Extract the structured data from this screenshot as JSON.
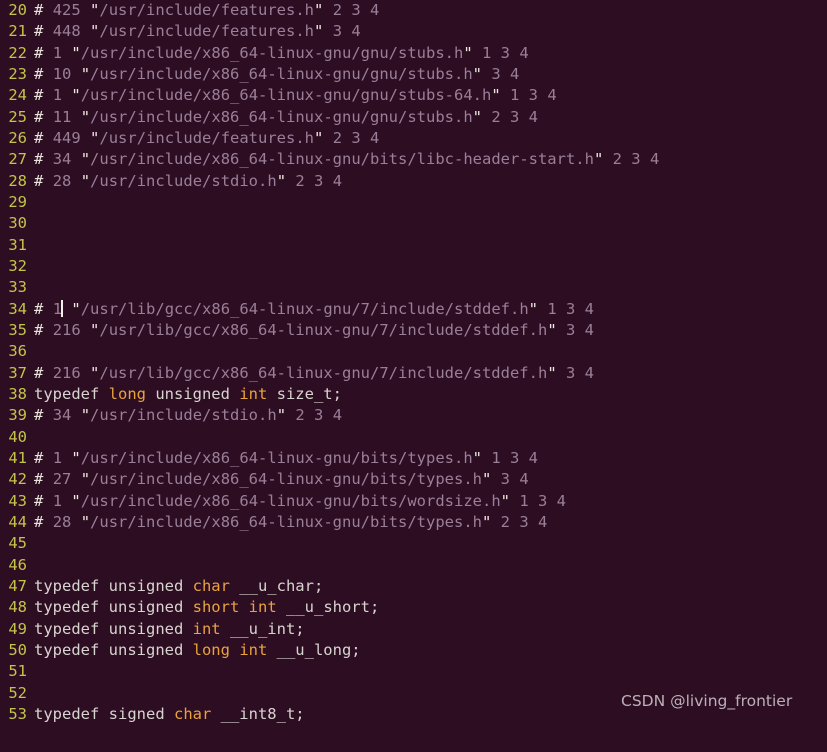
{
  "editor": {
    "background_color": "#2d0d22",
    "line_number_color": "#c4c44a",
    "first_visible_line": 20,
    "cursor": {
      "line": 34,
      "after_text": "# 1"
    },
    "lines": [
      {
        "num": "20",
        "tokens": [
          {
            "t": "hash",
            "v": "#"
          },
          {
            "t": "plainspace",
            "v": " "
          },
          {
            "t": "num",
            "v": "425"
          },
          {
            "t": "plainspace",
            "v": " "
          },
          {
            "t": "quote",
            "v": "\""
          },
          {
            "t": "path",
            "v": "/usr/include/features.h"
          },
          {
            "t": "quote",
            "v": "\""
          },
          {
            "t": "num",
            "v": " 2 3 4"
          }
        ]
      },
      {
        "num": "21",
        "tokens": [
          {
            "t": "hash",
            "v": "#"
          },
          {
            "t": "plainspace",
            "v": " "
          },
          {
            "t": "num",
            "v": "448"
          },
          {
            "t": "plainspace",
            "v": " "
          },
          {
            "t": "quote",
            "v": "\""
          },
          {
            "t": "path",
            "v": "/usr/include/features.h"
          },
          {
            "t": "quote",
            "v": "\""
          },
          {
            "t": "num",
            "v": " 3 4"
          }
        ]
      },
      {
        "num": "22",
        "tokens": [
          {
            "t": "hash",
            "v": "#"
          },
          {
            "t": "plainspace",
            "v": " "
          },
          {
            "t": "num",
            "v": "1"
          },
          {
            "t": "plainspace",
            "v": " "
          },
          {
            "t": "quote",
            "v": "\""
          },
          {
            "t": "path",
            "v": "/usr/include/x86_64-linux-gnu/gnu/stubs.h"
          },
          {
            "t": "quote",
            "v": "\""
          },
          {
            "t": "num",
            "v": " 1 3 4"
          }
        ]
      },
      {
        "num": "23",
        "tokens": [
          {
            "t": "hash",
            "v": "#"
          },
          {
            "t": "plainspace",
            "v": " "
          },
          {
            "t": "num",
            "v": "10"
          },
          {
            "t": "plainspace",
            "v": " "
          },
          {
            "t": "quote",
            "v": "\""
          },
          {
            "t": "path",
            "v": "/usr/include/x86_64-linux-gnu/gnu/stubs.h"
          },
          {
            "t": "quote",
            "v": "\""
          },
          {
            "t": "num",
            "v": " 3 4"
          }
        ]
      },
      {
        "num": "24",
        "tokens": [
          {
            "t": "hash",
            "v": "#"
          },
          {
            "t": "plainspace",
            "v": " "
          },
          {
            "t": "num",
            "v": "1"
          },
          {
            "t": "plainspace",
            "v": " "
          },
          {
            "t": "quote",
            "v": "\""
          },
          {
            "t": "path",
            "v": "/usr/include/x86_64-linux-gnu/gnu/stubs-64.h"
          },
          {
            "t": "quote",
            "v": "\""
          },
          {
            "t": "num",
            "v": " 1 3 4"
          }
        ]
      },
      {
        "num": "25",
        "tokens": [
          {
            "t": "hash",
            "v": "#"
          },
          {
            "t": "plainspace",
            "v": " "
          },
          {
            "t": "num",
            "v": "11"
          },
          {
            "t": "plainspace",
            "v": " "
          },
          {
            "t": "quote",
            "v": "\""
          },
          {
            "t": "path",
            "v": "/usr/include/x86_64-linux-gnu/gnu/stubs.h"
          },
          {
            "t": "quote",
            "v": "\""
          },
          {
            "t": "num",
            "v": " 2 3 4"
          }
        ]
      },
      {
        "num": "26",
        "tokens": [
          {
            "t": "hash",
            "v": "#"
          },
          {
            "t": "plainspace",
            "v": " "
          },
          {
            "t": "num",
            "v": "449"
          },
          {
            "t": "plainspace",
            "v": " "
          },
          {
            "t": "quote",
            "v": "\""
          },
          {
            "t": "path",
            "v": "/usr/include/features.h"
          },
          {
            "t": "quote",
            "v": "\""
          },
          {
            "t": "num",
            "v": " 2 3 4"
          }
        ]
      },
      {
        "num": "27",
        "tokens": [
          {
            "t": "hash",
            "v": "#"
          },
          {
            "t": "plainspace",
            "v": " "
          },
          {
            "t": "num",
            "v": "34"
          },
          {
            "t": "plainspace",
            "v": " "
          },
          {
            "t": "quote",
            "v": "\""
          },
          {
            "t": "path",
            "v": "/usr/include/x86_64-linux-gnu/bits/libc-header-start.h"
          },
          {
            "t": "quote",
            "v": "\""
          },
          {
            "t": "num",
            "v": " 2 3 4"
          }
        ]
      },
      {
        "num": "28",
        "tokens": [
          {
            "t": "hash",
            "v": "#"
          },
          {
            "t": "plainspace",
            "v": " "
          },
          {
            "t": "num",
            "v": "28"
          },
          {
            "t": "plainspace",
            "v": " "
          },
          {
            "t": "quote",
            "v": "\""
          },
          {
            "t": "path",
            "v": "/usr/include/stdio.h"
          },
          {
            "t": "quote",
            "v": "\""
          },
          {
            "t": "num",
            "v": " 2 3 4"
          }
        ]
      },
      {
        "num": "29",
        "tokens": []
      },
      {
        "num": "30",
        "tokens": []
      },
      {
        "num": "31",
        "tokens": []
      },
      {
        "num": "32",
        "tokens": []
      },
      {
        "num": "33",
        "tokens": []
      },
      {
        "num": "34",
        "tokens": [
          {
            "t": "hash",
            "v": "#"
          },
          {
            "t": "plainspace",
            "v": " "
          },
          {
            "t": "num",
            "v": "1"
          },
          {
            "t": "cursor",
            "v": ""
          },
          {
            "t": "plainspace",
            "v": " "
          },
          {
            "t": "quote",
            "v": "\""
          },
          {
            "t": "path",
            "v": "/usr/lib/gcc/x86_64-linux-gnu/7/include/stddef.h"
          },
          {
            "t": "quote",
            "v": "\""
          },
          {
            "t": "num",
            "v": " 1 3 4"
          }
        ]
      },
      {
        "num": "35",
        "tokens": [
          {
            "t": "hash",
            "v": "#"
          },
          {
            "t": "plainspace",
            "v": " "
          },
          {
            "t": "num",
            "v": "216"
          },
          {
            "t": "plainspace",
            "v": " "
          },
          {
            "t": "quote",
            "v": "\""
          },
          {
            "t": "path",
            "v": "/usr/lib/gcc/x86_64-linux-gnu/7/include/stddef.h"
          },
          {
            "t": "quote",
            "v": "\""
          },
          {
            "t": "num",
            "v": " 3 4"
          }
        ]
      },
      {
        "num": "36",
        "tokens": []
      },
      {
        "num": "37",
        "tokens": [
          {
            "t": "hash",
            "v": "#"
          },
          {
            "t": "plainspace",
            "v": " "
          },
          {
            "t": "num",
            "v": "216"
          },
          {
            "t": "plainspace",
            "v": " "
          },
          {
            "t": "quote",
            "v": "\""
          },
          {
            "t": "path",
            "v": "/usr/lib/gcc/x86_64-linux-gnu/7/include/stddef.h"
          },
          {
            "t": "quote",
            "v": "\""
          },
          {
            "t": "num",
            "v": " 3 4"
          }
        ]
      },
      {
        "num": "38",
        "tokens": [
          {
            "t": "plain",
            "v": "typedef "
          },
          {
            "t": "type",
            "v": "long"
          },
          {
            "t": "plain",
            "v": " unsigned "
          },
          {
            "t": "type",
            "v": "int"
          },
          {
            "t": "plain",
            "v": " size_t;"
          }
        ]
      },
      {
        "num": "39",
        "tokens": [
          {
            "t": "hash",
            "v": "#"
          },
          {
            "t": "plainspace",
            "v": " "
          },
          {
            "t": "num",
            "v": "34"
          },
          {
            "t": "plainspace",
            "v": " "
          },
          {
            "t": "quote",
            "v": "\""
          },
          {
            "t": "path",
            "v": "/usr/include/stdio.h"
          },
          {
            "t": "quote",
            "v": "\""
          },
          {
            "t": "num",
            "v": " 2 3 4"
          }
        ]
      },
      {
        "num": "40",
        "tokens": []
      },
      {
        "num": "41",
        "tokens": [
          {
            "t": "hash",
            "v": "#"
          },
          {
            "t": "plainspace",
            "v": " "
          },
          {
            "t": "num",
            "v": "1"
          },
          {
            "t": "plainspace",
            "v": " "
          },
          {
            "t": "quote",
            "v": "\""
          },
          {
            "t": "path",
            "v": "/usr/include/x86_64-linux-gnu/bits/types.h"
          },
          {
            "t": "quote",
            "v": "\""
          },
          {
            "t": "num",
            "v": " 1 3 4"
          }
        ]
      },
      {
        "num": "42",
        "tokens": [
          {
            "t": "hash",
            "v": "#"
          },
          {
            "t": "plainspace",
            "v": " "
          },
          {
            "t": "num",
            "v": "27"
          },
          {
            "t": "plainspace",
            "v": " "
          },
          {
            "t": "quote",
            "v": "\""
          },
          {
            "t": "path",
            "v": "/usr/include/x86_64-linux-gnu/bits/types.h"
          },
          {
            "t": "quote",
            "v": "\""
          },
          {
            "t": "num",
            "v": " 3 4"
          }
        ]
      },
      {
        "num": "43",
        "tokens": [
          {
            "t": "hash",
            "v": "#"
          },
          {
            "t": "plainspace",
            "v": " "
          },
          {
            "t": "num",
            "v": "1"
          },
          {
            "t": "plainspace",
            "v": " "
          },
          {
            "t": "quote",
            "v": "\""
          },
          {
            "t": "path",
            "v": "/usr/include/x86_64-linux-gnu/bits/wordsize.h"
          },
          {
            "t": "quote",
            "v": "\""
          },
          {
            "t": "num",
            "v": " 1 3 4"
          }
        ]
      },
      {
        "num": "44",
        "tokens": [
          {
            "t": "hash",
            "v": "#"
          },
          {
            "t": "plainspace",
            "v": " "
          },
          {
            "t": "num",
            "v": "28"
          },
          {
            "t": "plainspace",
            "v": " "
          },
          {
            "t": "quote",
            "v": "\""
          },
          {
            "t": "path",
            "v": "/usr/include/x86_64-linux-gnu/bits/types.h"
          },
          {
            "t": "quote",
            "v": "\""
          },
          {
            "t": "num",
            "v": " 2 3 4"
          }
        ]
      },
      {
        "num": "45",
        "tokens": []
      },
      {
        "num": "46",
        "tokens": []
      },
      {
        "num": "47",
        "tokens": [
          {
            "t": "plain",
            "v": "typedef unsigned "
          },
          {
            "t": "type",
            "v": "char"
          },
          {
            "t": "plain",
            "v": " __u_char;"
          }
        ]
      },
      {
        "num": "48",
        "tokens": [
          {
            "t": "plain",
            "v": "typedef unsigned "
          },
          {
            "t": "type",
            "v": "short"
          },
          {
            "t": "plain",
            "v": " "
          },
          {
            "t": "type",
            "v": "int"
          },
          {
            "t": "plain",
            "v": " __u_short;"
          }
        ]
      },
      {
        "num": "49",
        "tokens": [
          {
            "t": "plain",
            "v": "typedef unsigned "
          },
          {
            "t": "type",
            "v": "int"
          },
          {
            "t": "plain",
            "v": " __u_int;"
          }
        ]
      },
      {
        "num": "50",
        "tokens": [
          {
            "t": "plain",
            "v": "typedef unsigned "
          },
          {
            "t": "type",
            "v": "long"
          },
          {
            "t": "plain",
            "v": " "
          },
          {
            "t": "type",
            "v": "int"
          },
          {
            "t": "plain",
            "v": " __u_long;"
          }
        ]
      },
      {
        "num": "51",
        "tokens": []
      },
      {
        "num": "52",
        "tokens": []
      },
      {
        "num": "53",
        "tokens": [
          {
            "t": "plain",
            "v": "typedef signed "
          },
          {
            "t": "type",
            "v": "char"
          },
          {
            "t": "plain",
            "v": " __int8_t;"
          }
        ]
      }
    ]
  },
  "watermark": {
    "text": "CSDN @living_frontier"
  }
}
